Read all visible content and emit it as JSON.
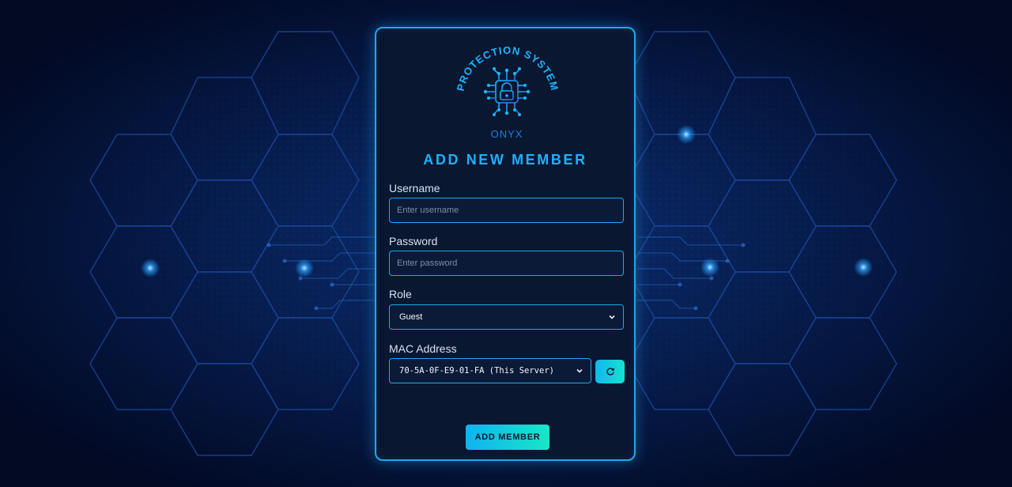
{
  "logo": {
    "arc_text": "PROTECTION SYSTEM",
    "brand": "ONYX",
    "icon": "circuit-lock-icon"
  },
  "form": {
    "title": "ADD NEW MEMBER",
    "username": {
      "label": "Username",
      "placeholder": "Enter username",
      "value": ""
    },
    "password": {
      "label": "Password",
      "placeholder": "Enter password",
      "value": ""
    },
    "role": {
      "label": "Role",
      "selected": "Guest"
    },
    "mac": {
      "label": "MAC Address",
      "selected": "70-5A-0F-E9-01-FA (This Server)"
    },
    "refresh_icon": "refresh-icon",
    "submit_label": "ADD MEMBER"
  },
  "colors": {
    "accent": "#1ea8f0",
    "button_gradient_start": "#0fb3f2",
    "button_gradient_end": "#19e6c6",
    "card_bg": "#0a1730",
    "page_bg": "#020a24"
  }
}
